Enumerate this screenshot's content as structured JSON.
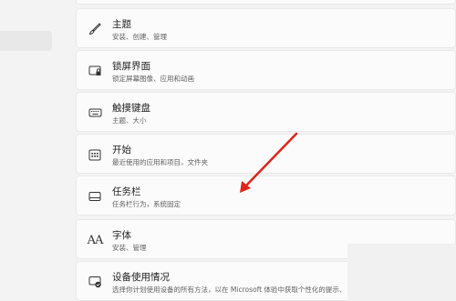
{
  "settings_list": {
    "items": [
      {
        "icon": "brush-icon",
        "title": "主题",
        "subtitle": "安装、创建、管理"
      },
      {
        "icon": "lockscreen-icon",
        "title": "锁屏界面",
        "subtitle": "锁定屏幕图像、应用和动画"
      },
      {
        "icon": "keyboard-icon",
        "title": "触摸键盘",
        "subtitle": "主题、大小"
      },
      {
        "icon": "start-icon",
        "title": "开始",
        "subtitle": "最近使用的应用和项目，文件夹"
      },
      {
        "icon": "taskbar-icon",
        "title": "任务栏",
        "subtitle": "任务栏行为，系统固定"
      },
      {
        "icon": "font-icon",
        "title": "字体",
        "subtitle": "安装、管理",
        "glyph": "AA"
      },
      {
        "icon": "device-usage-icon",
        "title": "设备使用情况",
        "subtitle": "选择你计划使用设备的所有方法，以在 Microsoft 体验中获取个性化的提示、"
      }
    ]
  },
  "colors": {
    "arrow": "#e2231a",
    "card_bg": "#fbfbfb",
    "page_bg": "#f3f3f3"
  }
}
